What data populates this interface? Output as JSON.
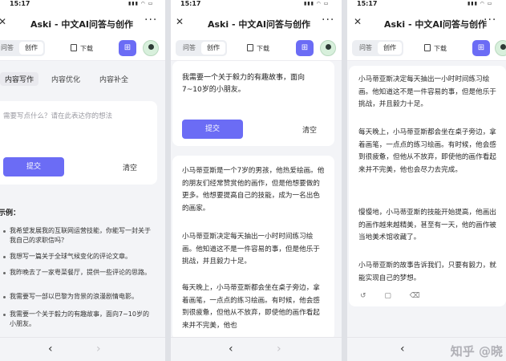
{
  "status": {
    "time": "15:17",
    "signal": "▮▮▮ ◠ ▭"
  },
  "app": {
    "title": "Aski - 中文AI问答与创作",
    "more": "···",
    "close": "✕"
  },
  "toolbar": {
    "tab_qa": "问答",
    "tab_create": "创作",
    "download": "下载"
  },
  "subtabs": [
    "内容写作",
    "内容优化",
    "内容补全"
  ],
  "input": {
    "placeholder": "需要写点什么？请在此表达你的想法"
  },
  "buttons": {
    "submit": "提交",
    "clear": "清空"
  },
  "examples": {
    "heading": "示例：",
    "items": [
      "我希望发展我的互联网运营技能，你能写一封关于我自己的求职信吗？",
      "我想写一篇关于全球气候变化的评论文章。",
      "我昨晚去了一家粤菜餐厅，提供一些评论的思路。",
      "我需要写一部以巴黎为背景的浪漫剧情电影。",
      "我需要一个关于毅力的有趣故事，面向7~10岁的小朋友。"
    ]
  },
  "prompt": "我需要一个关于毅力的有趣故事，面向7~10岁的小朋友。",
  "story_mid": [
    "小马蒂亚斯是一个7岁的男孩，他热爱绘画。他的朋友们经常赞赏他的画作，但是他想要做的更多。他想要提高自己的技能，成为一名出色的画家。",
    "小马蒂亚斯决定每天抽出一小时时间练习绘画。他知道这不是一件容易的事，但是他乐于挑战，并且毅力十足。",
    "每天晚上，小马蒂亚斯都会坐在桌子旁边，拿着画笔，一点点的练习绘画。有时候，他会感到很疲惫，但他从不放弃，即使他的画作看起来并不完美，他也"
  ],
  "story_right": [
    "小马蒂亚斯决定每天抽出一小时时间练习绘画。他知道这不是一件容易的事，但是他乐于挑战，并且毅力十足。",
    "每天晚上，小马蒂亚斯都会坐在桌子旁边，拿着画笔，一点点的练习绘画。有时候，他会感到很疲惫，但他从不放弃，即使他的画作看起来并不完美，他也会尽力去完成。",
    "慢慢地，小马蒂亚斯的技能开始提高，他画出的画作越来越精美，甚至有一天，他的画作被当地美术馆收藏了。",
    "小马蒂亚斯的故事告诉我们，只要有毅力，就能实现自己的梦想。"
  ],
  "result_actions": "↺ ▢ ⌫",
  "nav": {
    "back": "‹",
    "forward": "›"
  },
  "watermark": "知乎 @晓"
}
